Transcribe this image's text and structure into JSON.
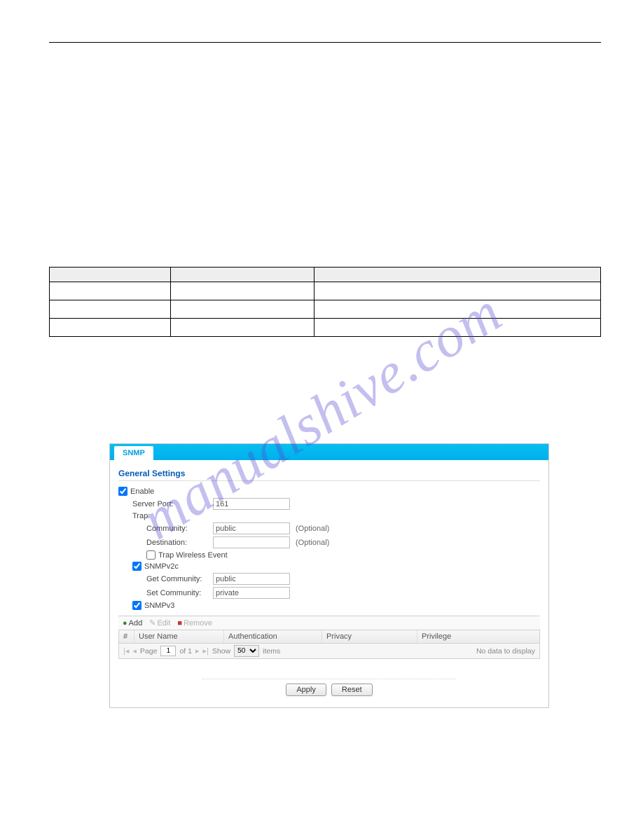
{
  "watermark": "manualshive.com",
  "version_table": {
    "headers": [
      "",
      "",
      ""
    ],
    "rows": [
      [
        "",
        "",
        ""
      ],
      [
        "",
        "",
        ""
      ],
      [
        "",
        "",
        ""
      ]
    ]
  },
  "snmp": {
    "tab_label": "SNMP",
    "section_title": "General Settings",
    "enable": {
      "label": "Enable",
      "checked": true
    },
    "server_port": {
      "label": "Server Port:",
      "value": "161"
    },
    "trap": {
      "header": "Trap:",
      "community": {
        "label": "Community:",
        "value": "public",
        "optional": "(Optional)"
      },
      "destination": {
        "label": "Destination:",
        "value": "",
        "optional": "(Optional)"
      },
      "wireless": {
        "label": "Trap Wireless Event",
        "checked": false
      }
    },
    "v2c": {
      "label": "SNMPv2c",
      "checked": true,
      "get": {
        "label": "Get Community:",
        "value": "public"
      },
      "set": {
        "label": "Set Community:",
        "value": "private"
      }
    },
    "v3": {
      "label": "SNMPv3",
      "checked": true
    },
    "toolbar": {
      "add": "Add",
      "edit": "Edit",
      "remove": "Remove"
    },
    "grid": {
      "headers": {
        "num": "#",
        "user": "User Name",
        "auth": "Authentication",
        "priv": "Privacy",
        "privilege": "Privilege"
      }
    },
    "pager": {
      "page_label_pre": "Page",
      "page": "1",
      "page_label_post": "of 1",
      "show_label": "Show",
      "per_page": "50",
      "items_label": "items",
      "nodata": "No data to display"
    },
    "buttons": {
      "apply": "Apply",
      "reset": "Reset"
    }
  }
}
